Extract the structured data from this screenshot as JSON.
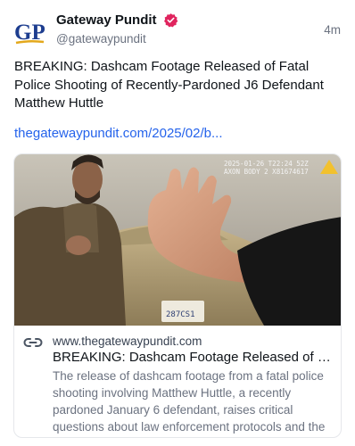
{
  "post": {
    "author": {
      "display_name": "Gateway Pundit",
      "handle": "@gatewaypundit",
      "avatar_text": "GP",
      "verified": true
    },
    "timestamp": "4m",
    "text": "BREAKING: Dashcam Footage Released of Fatal Police Shooting of Recently-Pardoned J6 Defendant Matthew Huttle",
    "link": "thegatewaypundit.com/2025/02/b...",
    "card": {
      "overlay_timestamp": "2025-01-26 T22:24 52Z",
      "overlay_device": "AXON BODY 2 X81674617",
      "plate_text": "287CS1",
      "domain": "www.thegatewaypundit.com",
      "title": "BREAKING: Dashcam Footage Released of Fat...",
      "description": "The release of dashcam footage from a fatal police shooting involving Matthew Huttle, a recently pardoned January 6 defendant, raises critical questions about law enforcement protocols and the implications of pardon..."
    }
  },
  "colors": {
    "link": "#2563eb",
    "verified_badge": "#e0245e",
    "avatar_blue": "#1d3d8f",
    "avatar_gold": "#e3a81c"
  },
  "icons": {
    "verified": "verified-badge-icon",
    "link": "link-chain-icon",
    "axon": "axon-logo-icon"
  }
}
